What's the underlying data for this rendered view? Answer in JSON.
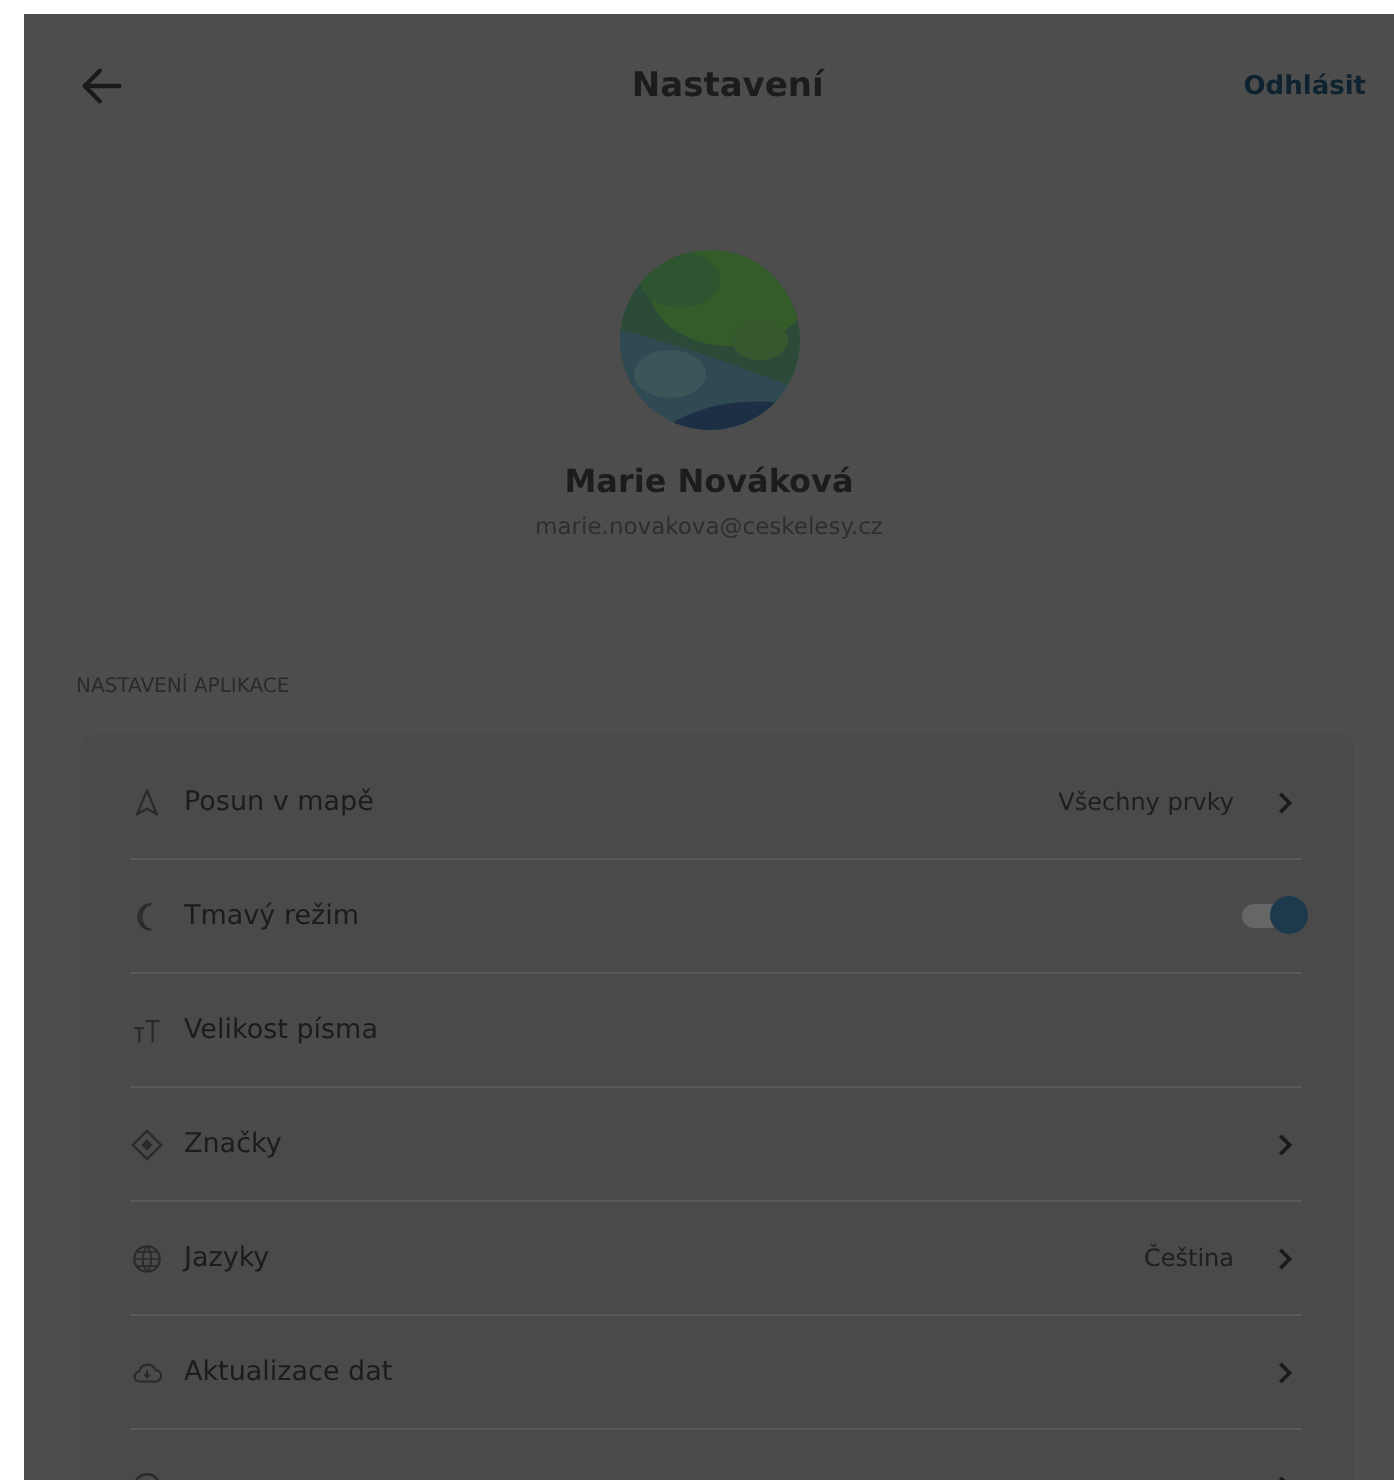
{
  "header": {
    "title": "Nastavení",
    "logout": "Odhlásit"
  },
  "profile": {
    "name": "Marie Nováková",
    "email": "marie.novakova@ceskelesy.cz"
  },
  "section": {
    "title": "NASTAVENÍ APLIKACE"
  },
  "settings": [
    {
      "kind": "link",
      "label": "Posun v mapě",
      "value": "Všechny prvky"
    },
    {
      "kind": "toggle",
      "label": "Tmavý režim",
      "on": true
    },
    {
      "kind": "plain",
      "label": "Velikost písma"
    },
    {
      "kind": "link",
      "label": "Značky"
    },
    {
      "kind": "link",
      "label": "Jazyky",
      "value": "Čeština"
    },
    {
      "kind": "link",
      "label": "Aktualizace dat"
    },
    {
      "kind": "link"
    }
  ]
}
